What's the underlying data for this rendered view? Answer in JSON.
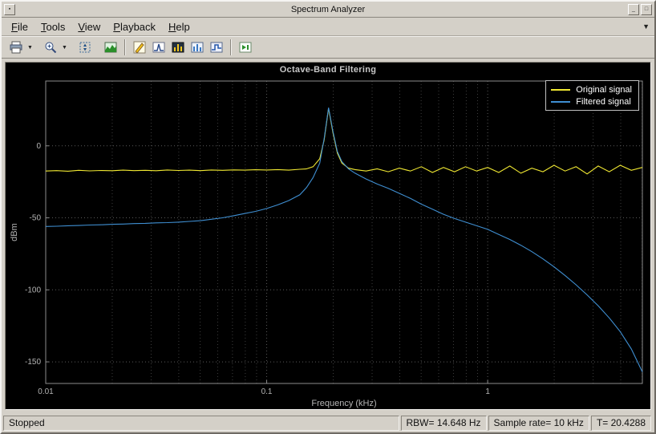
{
  "window": {
    "title": "Spectrum Analyzer"
  },
  "menu": {
    "items": [
      {
        "label": "File",
        "accel": 0
      },
      {
        "label": "Tools",
        "accel": 0
      },
      {
        "label": "View",
        "accel": 0
      },
      {
        "label": "Playback",
        "accel": 0
      },
      {
        "label": "Help",
        "accel": 0
      }
    ],
    "corner_glyph": "▼"
  },
  "toolbar": {
    "icons": [
      "print",
      "zoom-in",
      "scale-axes",
      "spectrogram",
      "cursor-measurements",
      "peak-finder",
      "distortion-measurements",
      "ccdf-measurements",
      "spectral-mask",
      "step-forward"
    ],
    "dropdown_glyph": "▼"
  },
  "chart_data": {
    "type": "line",
    "title": "Octave-Band Filtering",
    "xlabel": "Frequency (kHz)",
    "ylabel": "dBm",
    "xscale": "log",
    "xlim": [
      0.01,
      5.012
    ],
    "ylim": [
      -165,
      45
    ],
    "xticks": [
      0.01,
      0.1,
      1
    ],
    "yticks": [
      0,
      -50,
      -100,
      -150
    ],
    "grid": "dotted",
    "legend_position": "top-right",
    "background": "#000000",
    "x": [
      0.01,
      0.0112,
      0.0126,
      0.0141,
      0.0158,
      0.0178,
      0.02,
      0.0224,
      0.0251,
      0.0282,
      0.0316,
      0.0355,
      0.0398,
      0.0447,
      0.0501,
      0.0562,
      0.0631,
      0.0708,
      0.0794,
      0.0891,
      0.1,
      0.1122,
      0.1259,
      0.1413,
      0.1514,
      0.1622,
      0.1738,
      0.182,
      0.1905,
      0.1995,
      0.2089,
      0.2188,
      0.2344,
      0.2512,
      0.2818,
      0.3162,
      0.3548,
      0.3981,
      0.4467,
      0.5012,
      0.5623,
      0.631,
      0.7079,
      0.7943,
      0.8913,
      1.0,
      1.122,
      1.259,
      1.413,
      1.585,
      1.778,
      1.995,
      2.239,
      2.512,
      2.818,
      3.162,
      3.548,
      3.981,
      4.467,
      5.012
    ],
    "series": [
      {
        "name": "Original signal",
        "color": "#f0e832",
        "values": [
          -17.5,
          -17.2,
          -17.6,
          -17.0,
          -17.4,
          -17.1,
          -17.3,
          -16.9,
          -17.2,
          -17.0,
          -17.3,
          -16.8,
          -17.1,
          -16.9,
          -17.2,
          -16.8,
          -17.0,
          -16.7,
          -16.9,
          -16.6,
          -16.8,
          -16.5,
          -16.9,
          -16.3,
          -16.0,
          -14.5,
          -9.0,
          4.0,
          26.0,
          9.0,
          -5.0,
          -12.0,
          -15.5,
          -16.5,
          -17.5,
          -16.0,
          -18.0,
          -15.5,
          -17.5,
          -14.5,
          -18.5,
          -15.0,
          -18.0,
          -14.5,
          -17.5,
          -15.0,
          -18.5,
          -14.0,
          -19.0,
          -15.5,
          -18.0,
          -13.5,
          -17.5,
          -14.5,
          -19.5,
          -14.0,
          -18.0,
          -13.5,
          -17.0,
          -15.0
        ]
      },
      {
        "name": "Filtered signal",
        "color": "#3f8fd2",
        "values": [
          -56.0,
          -55.8,
          -55.5,
          -55.3,
          -55.0,
          -54.8,
          -54.5,
          -54.3,
          -54.0,
          -53.8,
          -53.5,
          -53.3,
          -53.0,
          -52.5,
          -52.0,
          -51.0,
          -50.0,
          -48.5,
          -47.0,
          -45.5,
          -43.5,
          -41.0,
          -38.0,
          -34.0,
          -29.0,
          -22.0,
          -12.0,
          5.0,
          26.5,
          10.0,
          -4.0,
          -11.0,
          -16.0,
          -19.0,
          -23.0,
          -26.5,
          -29.5,
          -33.0,
          -36.5,
          -40.5,
          -44.0,
          -47.5,
          -50.5,
          -53.0,
          -55.5,
          -58.0,
          -61.5,
          -65.0,
          -69.0,
          -73.5,
          -78.5,
          -84.0,
          -90.0,
          -96.5,
          -103.5,
          -111.0,
          -119.5,
          -129.0,
          -141.0,
          -157.0
        ]
      }
    ]
  },
  "statusbar": {
    "state": "Stopped",
    "rbw": "RBW= 14.648 Hz",
    "sample_rate": "Sample rate= 10 kHz",
    "time": "T= 20.4288"
  }
}
